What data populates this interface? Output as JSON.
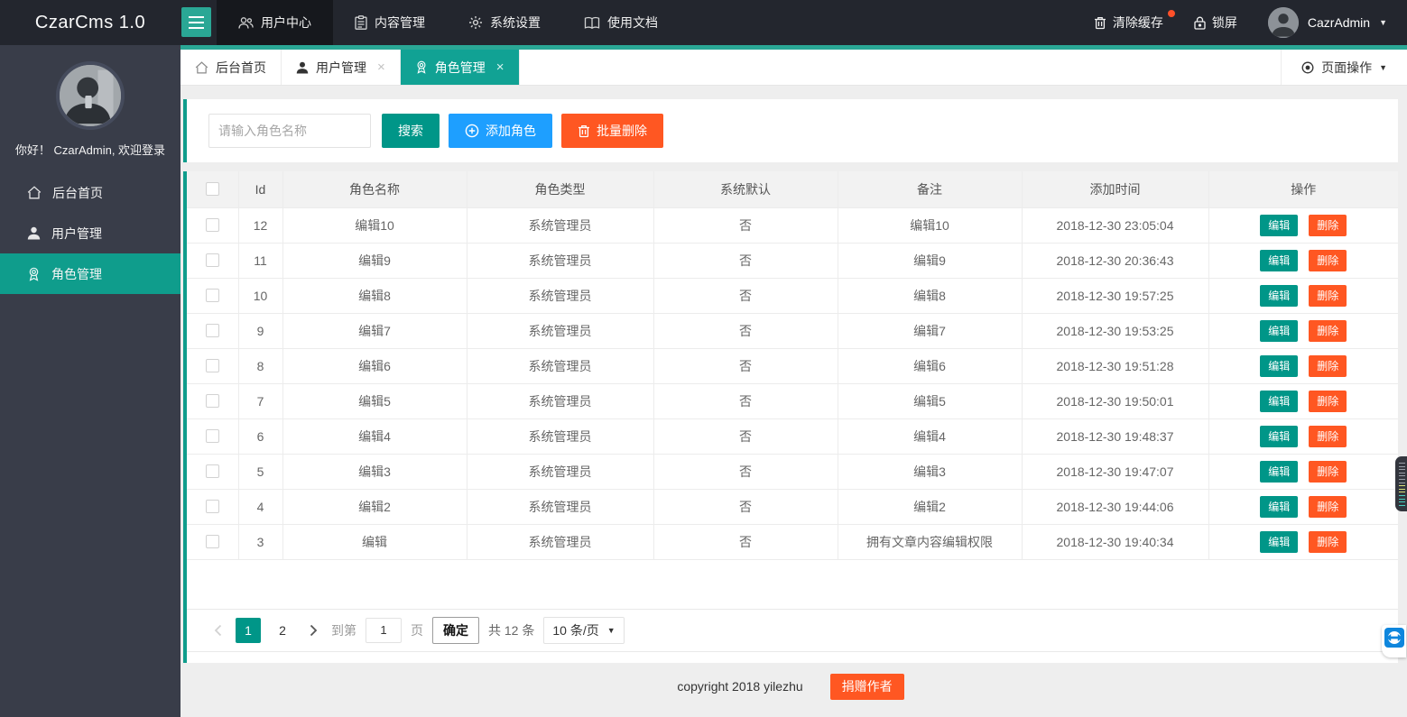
{
  "colors": {
    "accent_teal": "#009688",
    "tab_teal": "#11a294",
    "header_bg": "#23262e",
    "sidebar_bg": "#393d49",
    "blue": "#1e9fff",
    "orange": "#ff5722",
    "content_bg": "#eeeeee",
    "badge_red": "#ff5029",
    "teamviewer_blue": "#0e86dd"
  },
  "header": {
    "logo": "CzarCms 1.0",
    "nav": [
      {
        "label": "用户中心",
        "icon": "users-icon",
        "active": true
      },
      {
        "label": "内容管理",
        "icon": "clipboard-icon",
        "active": false
      },
      {
        "label": "系统设置",
        "icon": "gear-icon",
        "active": false
      },
      {
        "label": "使用文档",
        "icon": "book-icon",
        "active": false
      }
    ],
    "clear_cache_label": "清除缓存",
    "lock_label": "锁屏",
    "username": "CazrAdmin",
    "caret": "▼"
  },
  "sidebar": {
    "greeting": "你好！ CzarAdmin, 欢迎登录",
    "items": [
      {
        "label": "后台首页",
        "icon": "home-icon",
        "active": false
      },
      {
        "label": "用户管理",
        "icon": "user-icon",
        "active": false
      },
      {
        "label": "角色管理",
        "icon": "role-badge-icon",
        "active": true
      }
    ]
  },
  "tabbar": {
    "tabs": [
      {
        "label": "后台首页",
        "closable": false,
        "active": false
      },
      {
        "label": "用户管理",
        "closable": true,
        "active": false
      },
      {
        "label": "角色管理",
        "closable": true,
        "active": true
      }
    ],
    "close_glyph": "×",
    "page_actions_label": "页面操作",
    "page_actions_caret": "▼"
  },
  "toolbar": {
    "search_placeholder": "请输入角色名称",
    "search_label": "搜索",
    "add_role_label": "添加角色",
    "batch_delete_label": "批量删除"
  },
  "table": {
    "columns": [
      "Id",
      "角色名称",
      "角色类型",
      "系统默认",
      "备注",
      "添加时间",
      "操作"
    ],
    "edit_label": "编辑",
    "delete_label": "删除",
    "rows": [
      {
        "id": "12",
        "name": "编辑10",
        "type": "系统管理员",
        "sys_default": "否",
        "note": "编辑10",
        "time": "2018-12-30 23:05:04"
      },
      {
        "id": "11",
        "name": "编辑9",
        "type": "系统管理员",
        "sys_default": "否",
        "note": "编辑9",
        "time": "2018-12-30 20:36:43"
      },
      {
        "id": "10",
        "name": "编辑8",
        "type": "系统管理员",
        "sys_default": "否",
        "note": "编辑8",
        "time": "2018-12-30 19:57:25"
      },
      {
        "id": "9",
        "name": "编辑7",
        "type": "系统管理员",
        "sys_default": "否",
        "note": "编辑7",
        "time": "2018-12-30 19:53:25"
      },
      {
        "id": "8",
        "name": "编辑6",
        "type": "系统管理员",
        "sys_default": "否",
        "note": "编辑6",
        "time": "2018-12-30 19:51:28"
      },
      {
        "id": "7",
        "name": "编辑5",
        "type": "系统管理员",
        "sys_default": "否",
        "note": "编辑5",
        "time": "2018-12-30 19:50:01"
      },
      {
        "id": "6",
        "name": "编辑4",
        "type": "系统管理员",
        "sys_default": "否",
        "note": "编辑4",
        "time": "2018-12-30 19:48:37"
      },
      {
        "id": "5",
        "name": "编辑3",
        "type": "系统管理员",
        "sys_default": "否",
        "note": "编辑3",
        "time": "2018-12-30 19:47:07"
      },
      {
        "id": "4",
        "name": "编辑2",
        "type": "系统管理员",
        "sys_default": "否",
        "note": "编辑2",
        "time": "2018-12-30 19:44:06"
      },
      {
        "id": "3",
        "name": "编辑",
        "type": "系统管理员",
        "sys_default": "否",
        "note": "拥有文章内容编辑权限",
        "time": "2018-12-30 19:40:34"
      }
    ]
  },
  "pagination": {
    "pages": [
      "1",
      "2"
    ],
    "current_page": "1",
    "goto_prefix": "到第",
    "goto_value": "1",
    "goto_suffix": "页",
    "confirm_label": "确定",
    "total_label": "共 12 条",
    "page_size_label": "10 条/页",
    "select_caret": "▼"
  },
  "footer": {
    "copyright": "copyright 2018 yilezhu",
    "donate_label": "捐赠作者"
  }
}
